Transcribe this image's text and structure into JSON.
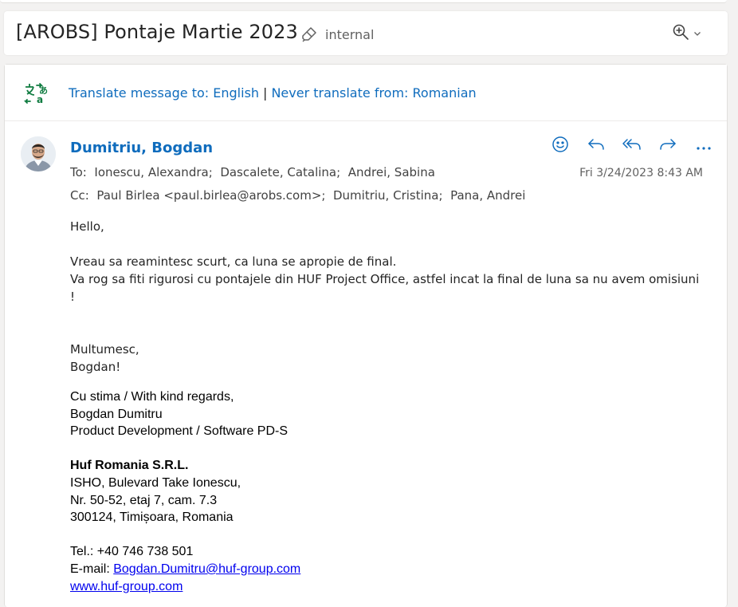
{
  "header": {
    "subject": "[AROBS] Pontaje Martie 2023",
    "tag_icon": "tag-eraser-icon",
    "tag_label": "internal",
    "zoom_icon": "zoom-in-icon"
  },
  "translate": {
    "icon": "translate-icon",
    "translate_label": "Translate message to: English",
    "separator": "|",
    "never_label": "Never translate from: Romanian"
  },
  "message": {
    "sender": "Dumitriu, Bogdan",
    "date": "Fri 3/24/2023 8:43 AM",
    "to_label": "To:",
    "to": [
      "Ionescu, Alexandra;",
      "Dascalete, Catalina;",
      "Andrei, Sabina"
    ],
    "cc_label": "Cc:",
    "cc": [
      "Paul Birlea <paul.birlea@arobs.com>;",
      "Dumitriu, Cristina;",
      "Pana, Andrei"
    ],
    "actions": [
      "smiley-icon",
      "reply-icon",
      "reply-all-icon",
      "forward-icon",
      "more-icon"
    ]
  },
  "body": {
    "greeting": "Hello,",
    "line1": "Vreau sa reamintesc scurt, ca luna se apropie de final.",
    "line2": "Va rog sa fiti rigurosi cu pontajele din HUF Project Office, astfel incat la final de luna sa nu avem omisiuni !",
    "thanks": "Multumesc,",
    "name": "Bogdan!"
  },
  "signature": {
    "regards": "Cu stima / With kind regards,",
    "name": "Bogdan Dumitru",
    "role": "Product Development / Software PD-S",
    "company": "Huf Romania S.R.L.",
    "addr1": "ISHO, Bulevard Take Ionescu,",
    "addr2": "Nr. 50-52, etaj 7, cam. 7.3",
    "addr3": "300124, Timișoara, Romania",
    "tel": "Tel.: +40 746 738 501",
    "email_label": "E-mail: ",
    "email": "Bogdan.Dumitru@huf-group.com",
    "web": "www.huf-group.com"
  },
  "colors": {
    "accent": "#0f6cbd",
    "translate_icon_green": "#107c41",
    "link_blue": "#0000ee"
  }
}
